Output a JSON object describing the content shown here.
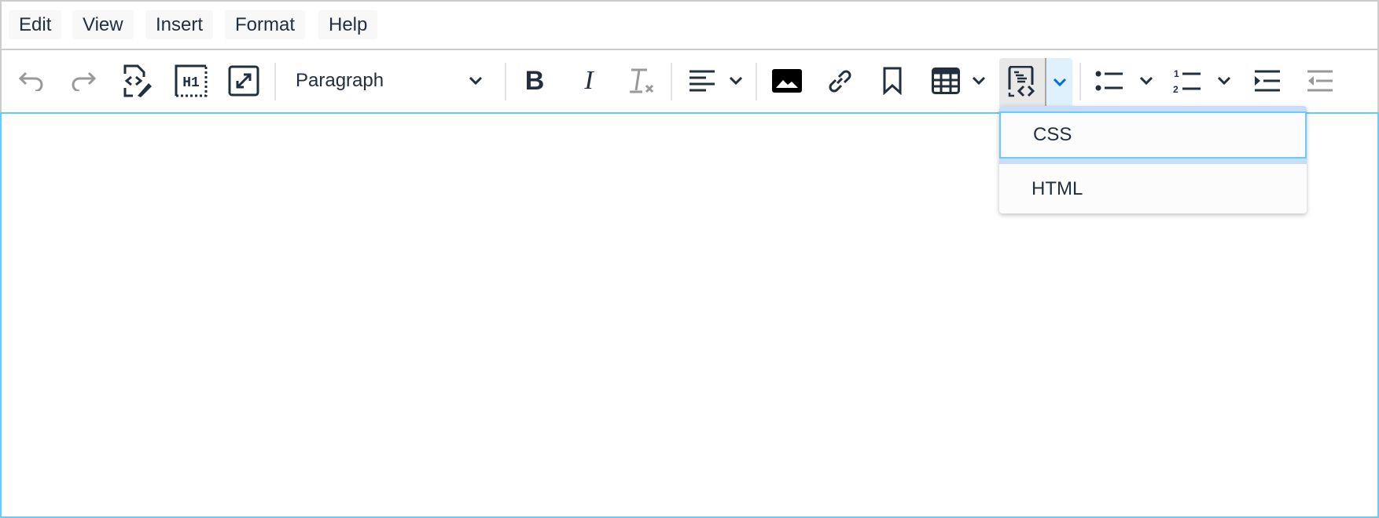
{
  "menubar": {
    "items": [
      "Edit",
      "View",
      "Insert",
      "Format",
      "Help"
    ]
  },
  "toolbar": {
    "block_format": "Paragraph",
    "buttons": [
      "undo-icon",
      "redo-icon",
      "source-code-icon",
      "heading-icon",
      "fullscreen-icon",
      "bold-icon",
      "italic-icon",
      "remove-format-icon",
      "align-left-icon",
      "image-icon",
      "link-icon",
      "bookmark-icon",
      "table-icon",
      "code-sample-icon",
      "bullet-list-icon",
      "numbered-list-icon",
      "indent-icon",
      "outdent-icon"
    ]
  },
  "codesample_menu": {
    "items": [
      "CSS",
      "HTML"
    ],
    "selected": "CSS"
  },
  "colors": {
    "accent": "#66ccff",
    "highlight": "#c8def8",
    "split_bg": "#dff1fc",
    "chevron_active": "#006ce7"
  }
}
